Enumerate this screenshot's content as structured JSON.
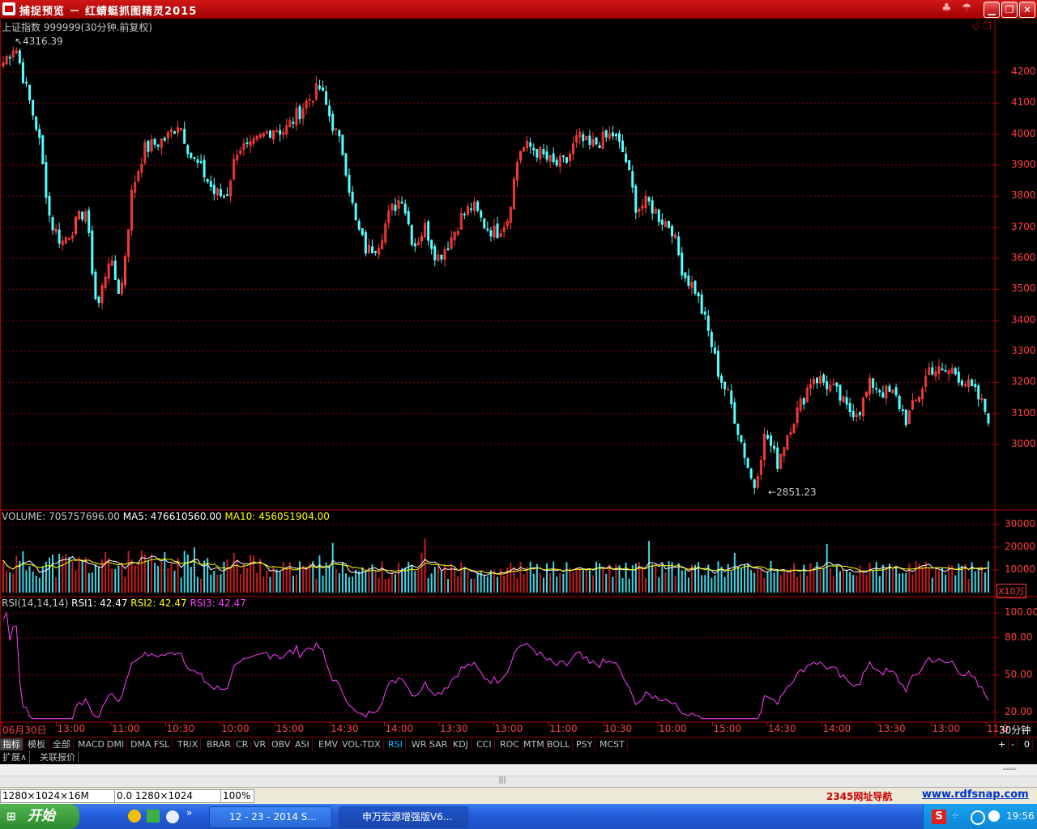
{
  "window": {
    "title": "捕捉预览 － 红蜻蜓抓图精灵2015"
  },
  "chart_header": {
    "label": "上证指数 999999(30分钟.前复权)"
  },
  "price_annotations": {
    "high": "4316.39",
    "low": "2851.23"
  },
  "price_axis": [
    "4200",
    "4100",
    "4000",
    "3900",
    "3800",
    "3700",
    "3600",
    "3500",
    "3400",
    "3300",
    "3200",
    "3100",
    "3000"
  ],
  "volume_header": {
    "volume": "VOLUME: 705757696.00",
    "ma5": "MA5: 476610560.00",
    "ma10": "MA10: 456051904.00"
  },
  "volume_axis": [
    "30000",
    "20000",
    "10000"
  ],
  "volume_unit": "X10万",
  "rsi_header": {
    "params": "RSI(14,14,14)",
    "rsi1": "RSI1: 42.47",
    "rsi2": "RSI2: 42.47",
    "rsi3": "RSI3: 42.47"
  },
  "rsi_axis": [
    "100.00",
    "80.00",
    "50.00",
    "20.00"
  ],
  "time_axis": [
    "06月30日",
    "13:00",
    "11:00",
    "10:30",
    "10:00",
    "15:00",
    "14:30",
    "14:00",
    "13:30",
    "13:00",
    "11:00",
    "10:30",
    "10:00",
    "15:00",
    "14:30",
    "14:00",
    "13:30",
    "13:00",
    "11:0"
  ],
  "period_label": "30分钟",
  "tabs_left": [
    "指标",
    "模板",
    "全部"
  ],
  "indicator_tabs": [
    "MACD",
    "DMI",
    "DMA",
    "FSL",
    "TRIX",
    "BRAR",
    "CR",
    "VR",
    "OBV",
    "ASI",
    "EMV",
    "VOL-TDX",
    "RSI",
    "WR",
    "SAR",
    "KDJ",
    "CCI",
    "ROC",
    "MTM",
    "BOLL",
    "PSY",
    "MCST"
  ],
  "active_indicator": "RSI",
  "nav_buttons": [
    "+",
    "-",
    "0"
  ],
  "tabs_row2": [
    "扩展∧",
    "关联报价"
  ],
  "status": {
    "size": "1280×1024×16M",
    "coords": "0.0 1280×1024",
    "zoom": "100%"
  },
  "links": {
    "nav": "2345网址导航",
    "site": "www.rdfsnap.com"
  },
  "taskbar": {
    "start": "开始",
    "tasks": [
      "12 - 23 - 2014 S...",
      "申万宏源增强版V6..."
    ],
    "clock": "19:56"
  },
  "colors": {
    "up": "#ff3c3c",
    "down": "#54ffff",
    "grid": "#8b0000",
    "ma5": "#ffffff",
    "ma10": "#ffff00",
    "rsi": "#ff40ff"
  },
  "chart_data": {
    "type": "candlestick",
    "price_range": [
      2851.23,
      4316.39
    ],
    "close_path": [
      4230,
      4290,
      4140,
      4000,
      3720,
      3650,
      3700,
      3760,
      3430,
      3600,
      3480,
      3820,
      3950,
      3970,
      3990,
      4040,
      3930,
      3880,
      3810,
      3800,
      3960,
      3950,
      3990,
      4020,
      4010,
      4060,
      4110,
      4150,
      4040,
      3940,
      3720,
      3620,
      3650,
      3750,
      3800,
      3640,
      3700,
      3600,
      3650,
      3730,
      3770,
      3710,
      3680,
      3730,
      3950,
      3960,
      3930,
      3900,
      3910,
      3990,
      3960,
      3980,
      4000,
      3930,
      3760,
      3780,
      3730,
      3700,
      3550,
      3500,
      3380,
      3230,
      3140,
      3000,
      2860,
      3040,
      2940,
      3050,
      3130,
      3220,
      3200,
      3170,
      3110,
      3110,
      3200,
      3170,
      3160,
      3080,
      3150,
      3250,
      3230,
      3240,
      3200,
      3160,
      3090
    ]
  }
}
